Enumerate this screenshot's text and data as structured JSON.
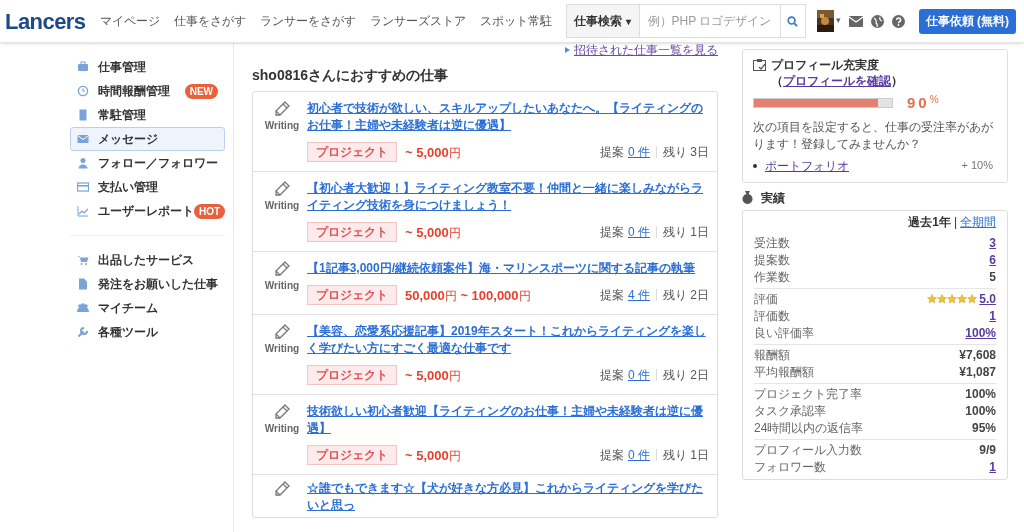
{
  "header": {
    "logo": "Lancers",
    "nav": [
      "マイページ",
      "仕事をさがす",
      "ランサーをさがす",
      "ランサーズストア",
      "スポット常駐"
    ],
    "search": {
      "category": "仕事検索",
      "caret": "▾",
      "placeholder": "例）PHP ロゴデザイン"
    },
    "user_caret": "▾",
    "cta": "仕事依頼 (無料)"
  },
  "sidebar": {
    "groups": [
      [
        {
          "label": "仕事管理",
          "selected": false
        },
        {
          "label": "時間報酬管理",
          "selected": false,
          "badge": "NEW"
        },
        {
          "label": "常駐管理",
          "selected": false
        },
        {
          "label": "メッセージ",
          "selected": true
        },
        {
          "label": "フォロー／フォロワー",
          "selected": false
        },
        {
          "label": "支払い管理",
          "selected": false
        },
        {
          "label": "ユーザーレポート",
          "selected": false,
          "badge": "HOT"
        }
      ],
      [
        {
          "label": "出品したサービス",
          "selected": false
        },
        {
          "label": "発注をお願いした仕事",
          "selected": false
        },
        {
          "label": "マイチーム",
          "selected": false
        },
        {
          "label": "各種ツール",
          "selected": false
        }
      ]
    ]
  },
  "main": {
    "invite_link": "招待された仕事一覧を見る",
    "heading": "sho0816さんにおすすめの仕事",
    "jobs": [
      {
        "category": "Writing",
        "title": "初心者で技術が欲しい、スキルアップしたいあなたへ。【ライティングのお仕事！主婦や未経験者は逆に優遇】",
        "tag": "プロジェクト",
        "price": [
          {
            "kind": "amount",
            "text": "~ 5,000"
          },
          {
            "kind": "unit",
            "text": "円"
          }
        ],
        "proposals_label": "提案",
        "proposals": "0 件",
        "remaining": "残り 3日"
      },
      {
        "category": "Writing",
        "title": "【初心者大歓迎！】ライティング教室不要！仲間と一緒に楽しみながらライティング技術を身につけましょう！",
        "tag": "プロジェクト",
        "price": [
          {
            "kind": "amount",
            "text": "~ 5,000"
          },
          {
            "kind": "unit",
            "text": "円"
          }
        ],
        "proposals_label": "提案",
        "proposals": "0 件",
        "remaining": "残り 1日"
      },
      {
        "category": "Writing",
        "title": "【1記事3,000円/継続依頼案件】海・マリンスポーツに関する記事の執筆",
        "tag": "プロジェクト",
        "price": [
          {
            "kind": "amount",
            "text": "50,000"
          },
          {
            "kind": "unit",
            "text": "円"
          },
          {
            "kind": "amount",
            "text": " ~ 100,000"
          },
          {
            "kind": "unit",
            "text": "円"
          }
        ],
        "proposals_label": "提案",
        "proposals": "4 件",
        "remaining": "残り 2日"
      },
      {
        "category": "Writing",
        "title": "【美容、恋愛系応援記事】2019年スタート！これからライティングを楽しく学びたい方にすごく最適な仕事です",
        "tag": "プロジェクト",
        "price": [
          {
            "kind": "amount",
            "text": "~ 5,000"
          },
          {
            "kind": "unit",
            "text": "円"
          }
        ],
        "proposals_label": "提案",
        "proposals": "0 件",
        "remaining": "残り 2日"
      },
      {
        "category": "Writing",
        "title": "技術欲しい初心者歓迎【ライティングのお仕事！主婦や未経験者は逆に優遇】",
        "tag": "プロジェクト",
        "price": [
          {
            "kind": "amount",
            "text": "~ 5,000"
          },
          {
            "kind": "unit",
            "text": "円"
          }
        ],
        "proposals_label": "提案",
        "proposals": "0 件",
        "remaining": "残り 1日"
      },
      {
        "title": "☆誰でもできます☆【犬が好きな方必見】これからライティングを学びたいと思っ"
      }
    ]
  },
  "profile": {
    "title_before": "プロフィール充実度（",
    "link": "プロフィールを確認",
    "title_after": "）",
    "level": 0.9,
    "percent": "90",
    "percent_sign": "%",
    "message": "次の項目を設定すると、仕事の受注率があがります！登録してみませんか？",
    "items": [
      {
        "label": "ポートフォリオ",
        "gain": "+ 10%"
      }
    ]
  },
  "stats": {
    "title": "実績",
    "period": "過去1年",
    "separator": "|",
    "all_period": "全期間",
    "groups": [
      [
        {
          "label": "受注数",
          "value": "3",
          "linked": true
        },
        {
          "label": "提案数",
          "value": "6",
          "linked": true
        },
        {
          "label": "作業数",
          "value": "5",
          "linked": false
        }
      ],
      [
        {
          "label": "評価",
          "value": "5.0",
          "linked": true,
          "stars": 5
        },
        {
          "label": "評価数",
          "value": "1",
          "linked": true
        },
        {
          "label": "良い評価率",
          "value": "100%",
          "linked": true
        }
      ],
      [
        {
          "label": "報酬額",
          "value": "¥7,608",
          "linked": false
        },
        {
          "label": "平均報酬額",
          "value": "¥1,087",
          "linked": false
        }
      ],
      [
        {
          "label": "プロジェクト完了率",
          "value": "100%",
          "linked": false
        },
        {
          "label": "タスク承認率",
          "value": "100%",
          "linked": false
        },
        {
          "label": "24時間以内の返信率",
          "value": "95%",
          "linked": false
        }
      ],
      [
        {
          "label": "プロフィール入力数",
          "value": "9/9",
          "linked": false
        },
        {
          "label": "フォロワー数",
          "value": "1",
          "linked": true
        }
      ]
    ]
  }
}
